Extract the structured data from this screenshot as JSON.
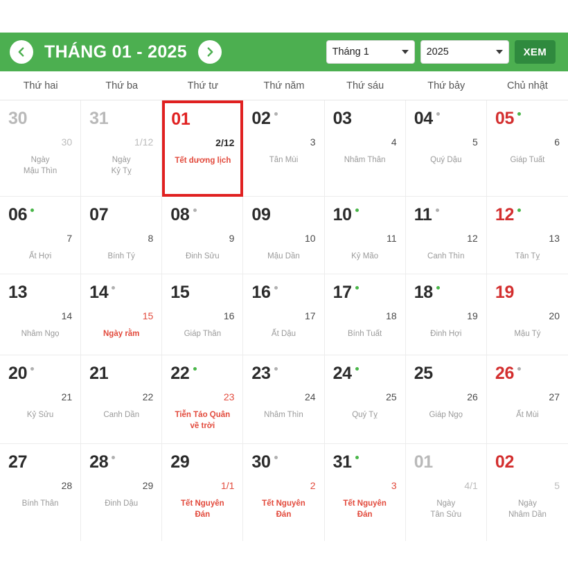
{
  "header": {
    "prev_icon": "chevron-left-icon",
    "next_icon": "chevron-right-icon",
    "title": "THÁNG 01 - 2025",
    "month_select": {
      "value": "Tháng 1"
    },
    "year_select": {
      "value": "2025"
    },
    "view_button": "XEM",
    "accent_green": "#4caf50",
    "button_green": "#2f8a3e"
  },
  "weekdays": [
    "Thứ hai",
    "Thứ ba",
    "Thứ tư",
    "Thứ năm",
    "Thứ sáu",
    "Thứ bảy",
    "Chủ nhật"
  ],
  "days": [
    {
      "num": "30",
      "lunar": "30",
      "note": "Ngày\nMậu Thìn",
      "dot": "none",
      "outside": true
    },
    {
      "num": "31",
      "lunar": "1/12",
      "note": "Ngày\nKỷ Tỵ",
      "dot": "none",
      "outside": true
    },
    {
      "num": "01",
      "lunar": "2/12",
      "note": "Tết dương lịch",
      "dot": "none",
      "selected": true,
      "lunar_style": "dark",
      "note_style": "red"
    },
    {
      "num": "02",
      "lunar": "3",
      "note": "Tân Mùi",
      "dot": "gray"
    },
    {
      "num": "03",
      "lunar": "4",
      "note": "Nhâm Thân",
      "dot": "none"
    },
    {
      "num": "04",
      "lunar": "5",
      "note": "Quý Dậu",
      "dot": "gray"
    },
    {
      "num": "05",
      "lunar": "6",
      "note": "Giáp Tuất",
      "dot": "green",
      "sunday": true
    },
    {
      "num": "06",
      "lunar": "7",
      "note": "Ất Hợi",
      "dot": "green"
    },
    {
      "num": "07",
      "lunar": "8",
      "note": "Bính Tý",
      "dot": "none"
    },
    {
      "num": "08",
      "lunar": "9",
      "note": "Đinh Sửu",
      "dot": "gray"
    },
    {
      "num": "09",
      "lunar": "10",
      "note": "Mậu Dần",
      "dot": "none"
    },
    {
      "num": "10",
      "lunar": "11",
      "note": "Kỷ Mão",
      "dot": "green"
    },
    {
      "num": "11",
      "lunar": "12",
      "note": "Canh Thìn",
      "dot": "gray"
    },
    {
      "num": "12",
      "lunar": "13",
      "note": "Tân Tỵ",
      "dot": "green",
      "sunday": true
    },
    {
      "num": "13",
      "lunar": "14",
      "note": "Nhâm Ngọ",
      "dot": "none"
    },
    {
      "num": "14",
      "lunar": "15",
      "note": "Ngày rằm",
      "dot": "gray",
      "lunar_style": "red",
      "note_style": "red"
    },
    {
      "num": "15",
      "lunar": "16",
      "note": "Giáp Thân",
      "dot": "none"
    },
    {
      "num": "16",
      "lunar": "17",
      "note": "Ất Dậu",
      "dot": "gray"
    },
    {
      "num": "17",
      "lunar": "18",
      "note": "Bính Tuất",
      "dot": "green"
    },
    {
      "num": "18",
      "lunar": "19",
      "note": "Đinh Hợi",
      "dot": "green"
    },
    {
      "num": "19",
      "lunar": "20",
      "note": "Mậu Tý",
      "dot": "none",
      "sunday": true
    },
    {
      "num": "20",
      "lunar": "21",
      "note": "Kỷ Sửu",
      "dot": "gray"
    },
    {
      "num": "21",
      "lunar": "22",
      "note": "Canh Dần",
      "dot": "none"
    },
    {
      "num": "22",
      "lunar": "23",
      "note": "Tiễn Táo Quân\nvề trời",
      "dot": "green",
      "lunar_style": "red",
      "note_style": "red"
    },
    {
      "num": "23",
      "lunar": "24",
      "note": "Nhâm Thìn",
      "dot": "gray"
    },
    {
      "num": "24",
      "lunar": "25",
      "note": "Quý Tỵ",
      "dot": "green"
    },
    {
      "num": "25",
      "lunar": "26",
      "note": "Giáp Ngọ",
      "dot": "none"
    },
    {
      "num": "26",
      "lunar": "27",
      "note": "Ất Mùi",
      "dot": "gray",
      "sunday": true
    },
    {
      "num": "27",
      "lunar": "28",
      "note": "Bính Thân",
      "dot": "none"
    },
    {
      "num": "28",
      "lunar": "29",
      "note": "Đinh Dậu",
      "dot": "gray"
    },
    {
      "num": "29",
      "lunar": "1/1",
      "note": "Tết Nguyên\nĐán",
      "dot": "none",
      "lunar_style": "red",
      "note_style": "red"
    },
    {
      "num": "30",
      "lunar": "2",
      "note": "Tết Nguyên\nĐán",
      "dot": "gray",
      "lunar_style": "red",
      "note_style": "red"
    },
    {
      "num": "31",
      "lunar": "3",
      "note": "Tết Nguyên\nĐán",
      "dot": "green",
      "lunar_style": "red",
      "note_style": "red"
    },
    {
      "num": "01",
      "lunar": "4/1",
      "note": "Ngày\nTân Sửu",
      "dot": "none",
      "outside": true
    },
    {
      "num": "02",
      "lunar": "5",
      "note": "Ngày\nNhâm Dần",
      "dot": "none",
      "outside": true,
      "sunday": true
    }
  ]
}
